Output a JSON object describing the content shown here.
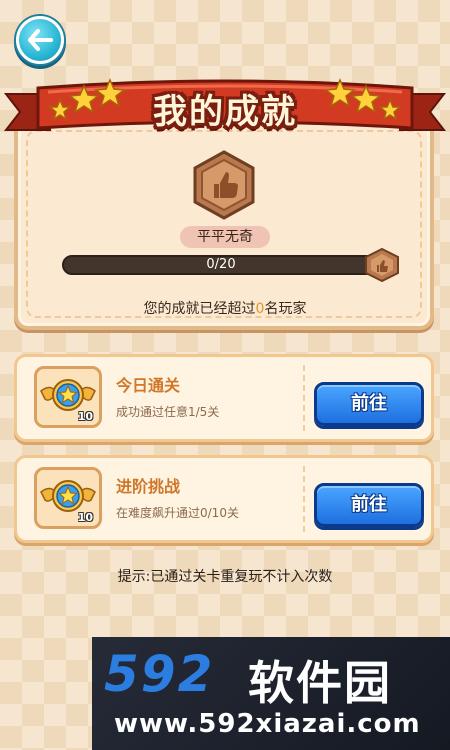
{
  "header": {
    "back_icon": "arrow-left-icon",
    "title": "我的成就"
  },
  "achievement": {
    "medal_icon": "thumbs-up-medal-icon",
    "level_name": "平平无奇",
    "progress_text": "0/20",
    "progress_fraction": 0,
    "rank_prefix": "您的成就已经超过",
    "rank_value": "0",
    "rank_suffix": "名玩家"
  },
  "tasks": [
    {
      "icon": "winged-star-badge-icon",
      "reward_count": "10",
      "title": "今日通关",
      "description": "成功通过任意1/5关",
      "button_label": "前往"
    },
    {
      "icon": "winged-star-badge-icon",
      "reward_count": "10",
      "title": "进阶挑战",
      "description": "在难度飙升通过0/10关",
      "button_label": "前往"
    }
  ],
  "hint": "提示:已通过关卡重复玩不计入次数",
  "watermark": {
    "number": "592",
    "name": "软件园",
    "url": "www.592xiazai.com"
  },
  "colors": {
    "accent_orange": "#d0772a",
    "button_blue": "#1f6fe0",
    "ribbon_red": "#c2311f",
    "watermark_blue": "#2c7de0"
  }
}
